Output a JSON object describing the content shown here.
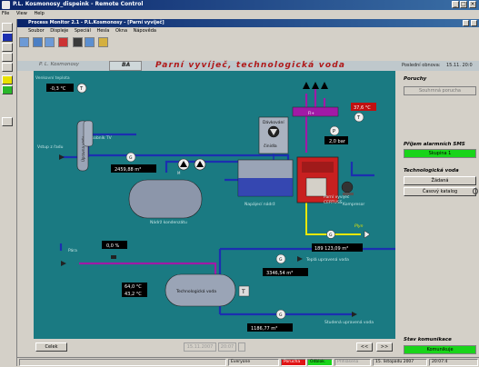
{
  "outer_window": {
    "title": "P.L. Kosmonosy_dispeink - Remote Control",
    "menu": [
      "File",
      "View",
      "Help"
    ]
  },
  "inner_window": {
    "title": "Process Monitor 2.1 - P.L.Kosmonosy - [Parní vyvíječ]",
    "menu": [
      "Soubor",
      "Displeje",
      "Speciál",
      "Hesla",
      "Okna",
      "Nápověda"
    ]
  },
  "header": {
    "location": "P. L. Kosmonosy",
    "code": "BA",
    "title": "Parní vyvíječ, technologická voda",
    "last_update_label": "Poslední obnova:",
    "last_update_value": "15.11. 20:0"
  },
  "diagram": {
    "outside_temp": "-0,3 °C",
    "outdoor_temp_label": "Venkovní teplota",
    "inlet_water_label": "Vstup z řadu",
    "tank_tv_label": "Zásobník TV",
    "softener_label": "Úpravna vody",
    "flow_main": "2459,88 m³",
    "condensate_tank_label": "Nádrž kondenzátu",
    "feed_tank_label": "Napájecí nádrž",
    "doser_label": "Dávkování",
    "doser_sub": "činidla",
    "temp_boiler": "37,6 °C",
    "pressure_label": "P",
    "pressure_value": "2,0 bar",
    "boiler_label": "Parní vyvíječ",
    "boiler_sub": "CERTUSS",
    "pump_label": "Kompresor",
    "gas_label": "Plyn",
    "gas_value": "189 123,09 m³",
    "steam_label": "Pára",
    "steam_percent": "0,0 %",
    "hot_water_label": "Teplá upravená voda",
    "hot_water_flow": "3346,54 m³",
    "cold_water_label": "Studená upravená voda",
    "cold_water_flow": "1186,77 m³",
    "tech_water_label": "Technologická voda",
    "tech_temp1": "64,0 °C",
    "tech_temp2": "43,2 °C",
    "t_marker": "T",
    "g_marker": "G"
  },
  "right_panel": {
    "faults_heading": "Poruchy",
    "faults_value": "Souhrnná porucha",
    "sms_heading": "Příjem alarmních SMS",
    "sms_value": "Skupina 1",
    "tech_heading": "Technologická voda",
    "request_button": "Žádaná",
    "time_catalog_button": "Časový katalog",
    "comm_heading": "Stav komunikace",
    "comm_value": "Komunikuje"
  },
  "bottom_bar": {
    "full_button": "Celek",
    "date_field": "15.11.2007",
    "time_field": "20:07",
    "prev_button": "<<",
    "next_button": ">>"
  },
  "status_bar": {
    "user": "Everyone",
    "fault": "Porucha",
    "ok": "Odblok.",
    "register": "Příhlášena",
    "date": "15. listopadu 2007",
    "time": "20:07:4"
  },
  "colors": {
    "diagram_bg": "#1a7a82",
    "water_pipe": "#1c2fb0",
    "steam_pipe": "#a01aa6",
    "gas_pipe": "#e8e800",
    "status_green": "#19d41a",
    "status_red": "#e01515",
    "value_box_bg": "#000000",
    "value_text": "#ffffff",
    "alarm_box": "#cc0000"
  }
}
